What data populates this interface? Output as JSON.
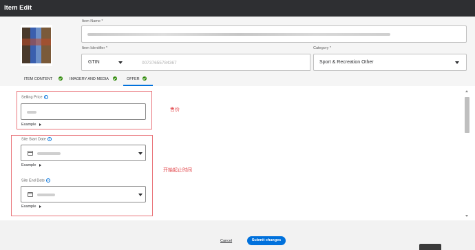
{
  "window": {
    "title": "Item Edit"
  },
  "header": {
    "item_name": {
      "label": "Item Name *",
      "value_text": ""
    },
    "item_identifier": {
      "label": "Item Identifier *",
      "type_value": "GTIN",
      "id_value": "00737655784367"
    },
    "category": {
      "label": "Category *",
      "value": "Sport & Recreation Other"
    }
  },
  "tabs": [
    {
      "label": "ITEM CONTENT",
      "complete": true,
      "active": false
    },
    {
      "label": "IMAGERY AND MEDIA",
      "complete": true,
      "active": false
    },
    {
      "label": "OFFER",
      "complete": true,
      "active": true
    }
  ],
  "offer": {
    "selling_price": {
      "label": "Selling Price",
      "example": "Example"
    },
    "site_start": {
      "label": "Site Start Date",
      "example": "Example"
    },
    "site_end": {
      "label": "Site End Date",
      "example": "Example"
    }
  },
  "annotations": {
    "price": "售价",
    "dates": "开始起止时间"
  },
  "footer": {
    "cancel": "Cancel",
    "submit": "Submit changes"
  },
  "colors": {
    "accent": "#0071dc",
    "success": "#2a8703",
    "annotation": "#e0393e",
    "titlebar": "#2e2f32"
  }
}
